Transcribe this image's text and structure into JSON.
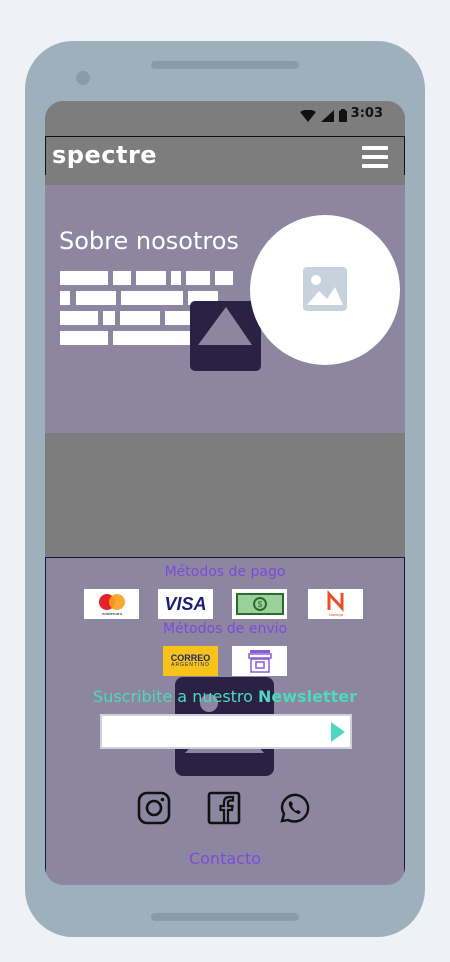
{
  "status": {
    "time": "3:03"
  },
  "header": {
    "brand": "spectre"
  },
  "hero": {
    "title": "Sobre nosotros"
  },
  "footer": {
    "payment_title": "Métodos de pago",
    "payments": [
      {
        "name": "mastercard",
        "label": "mastercard"
      },
      {
        "name": "visa",
        "label": "VISA"
      },
      {
        "name": "cash",
        "label": "$"
      },
      {
        "name": "naranja",
        "label": "Naranja"
      }
    ],
    "shipping_title": "Métodos de envio",
    "shipping": [
      {
        "name": "correo-argentino",
        "label": "CORREO",
        "sublabel": "ARGENTINO"
      },
      {
        "name": "store-pickup",
        "label": ""
      }
    ],
    "newsletter_prefix": "Suscribite a nuestro ",
    "newsletter_bold": "Newsletter",
    "newsletter_placeholder": "",
    "contact": "Contacto"
  },
  "colors": {
    "accent": "#7d4bd9",
    "teal": "#4fd8c0",
    "dark": "#2a2245",
    "gray": "#7d7d7d",
    "purple_gray": "#8c86a0"
  }
}
